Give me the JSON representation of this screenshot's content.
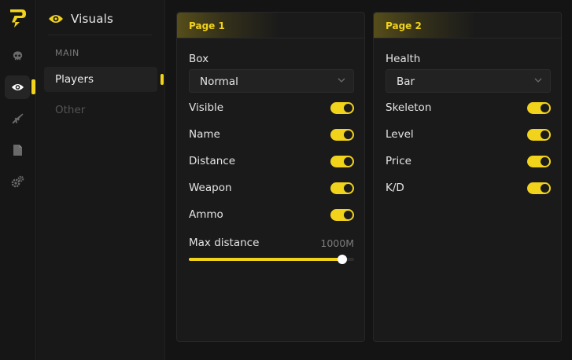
{
  "app": {
    "accent_color": "#f2d31b",
    "logo_icon": "brand-p-logo-icon"
  },
  "rail": {
    "items": [
      {
        "icon": "skull-icon",
        "active": false
      },
      {
        "icon": "eye-icon",
        "active": true
      },
      {
        "icon": "rifle-icon",
        "active": false
      },
      {
        "icon": "file-icon",
        "active": false
      },
      {
        "icon": "gears-icon",
        "active": false
      }
    ]
  },
  "sidebar": {
    "title": "Visuals",
    "title_icon": "eye-icon",
    "section_label": "MAIN",
    "items": [
      {
        "label": "Players",
        "active": true
      },
      {
        "label": "Other",
        "active": false
      }
    ]
  },
  "pages": [
    {
      "title": "Page 1",
      "select": {
        "label": "Box",
        "value": "Normal"
      },
      "toggles": [
        {
          "label": "Visible",
          "on": true
        },
        {
          "label": "Name",
          "on": true
        },
        {
          "label": "Distance",
          "on": true
        },
        {
          "label": "Weapon",
          "on": true
        },
        {
          "label": "Ammo",
          "on": true
        }
      ],
      "slider": {
        "label": "Max distance",
        "value": "1000M",
        "fraction": 0.93
      }
    },
    {
      "title": "Page 2",
      "select": {
        "label": "Health",
        "value": "Bar"
      },
      "toggles": [
        {
          "label": "Skeleton",
          "on": true
        },
        {
          "label": "Level",
          "on": true
        },
        {
          "label": "Price",
          "on": true
        },
        {
          "label": "K/D",
          "on": true
        }
      ]
    }
  ]
}
